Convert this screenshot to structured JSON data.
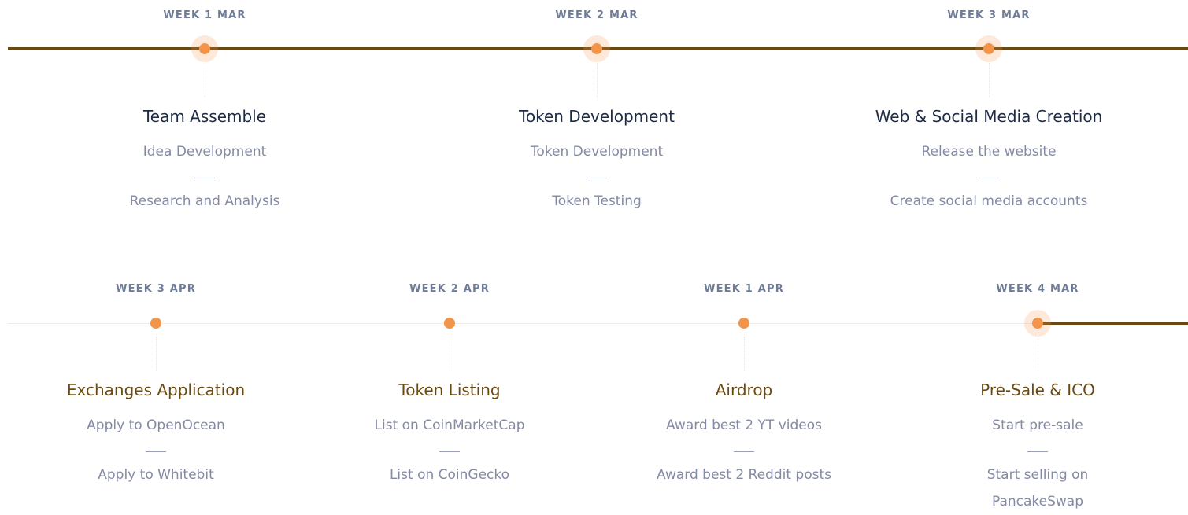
{
  "roadmap": {
    "row1": [
      {
        "week": "WEEK 1 MAR",
        "title": "Team Assemble",
        "item1": "Idea Development",
        "item2": "Research and Analysis"
      },
      {
        "week": "WEEK 2 MAR",
        "title": "Token Development",
        "item1": "Token Development",
        "item2": "Token Testing"
      },
      {
        "week": "WEEK 3 MAR",
        "title": "Web & Social Media Creation",
        "item1": "Release the website",
        "item2": "Create social media accounts"
      }
    ],
    "row2": [
      {
        "week": "WEEK 3 APR",
        "title": "Exchanges Application",
        "item1": "Apply to OpenOcean",
        "item2": "Apply to Whitebit"
      },
      {
        "week": "WEEK 2 APR",
        "title": "Token Listing",
        "item1": "List on CoinMarketCap",
        "item2": "List on CoinGecko"
      },
      {
        "week": "WEEK 1 APR",
        "title": "Airdrop",
        "item1": "Award best 2 YT videos",
        "item2": "Award best 2 Reddit posts"
      },
      {
        "week": "WEEK 4 MAR",
        "title": "Pre-Sale & ICO",
        "item1": "Start pre-sale",
        "item2": "Start selling on PancakeSwap"
      }
    ]
  },
  "colors": {
    "active_line": "#6b4a12",
    "dot": "#f2954a",
    "week_label": "#6f7c96",
    "title": "#1e2b45",
    "title_alt": "#6b4a12",
    "text": "#838aa3"
  }
}
